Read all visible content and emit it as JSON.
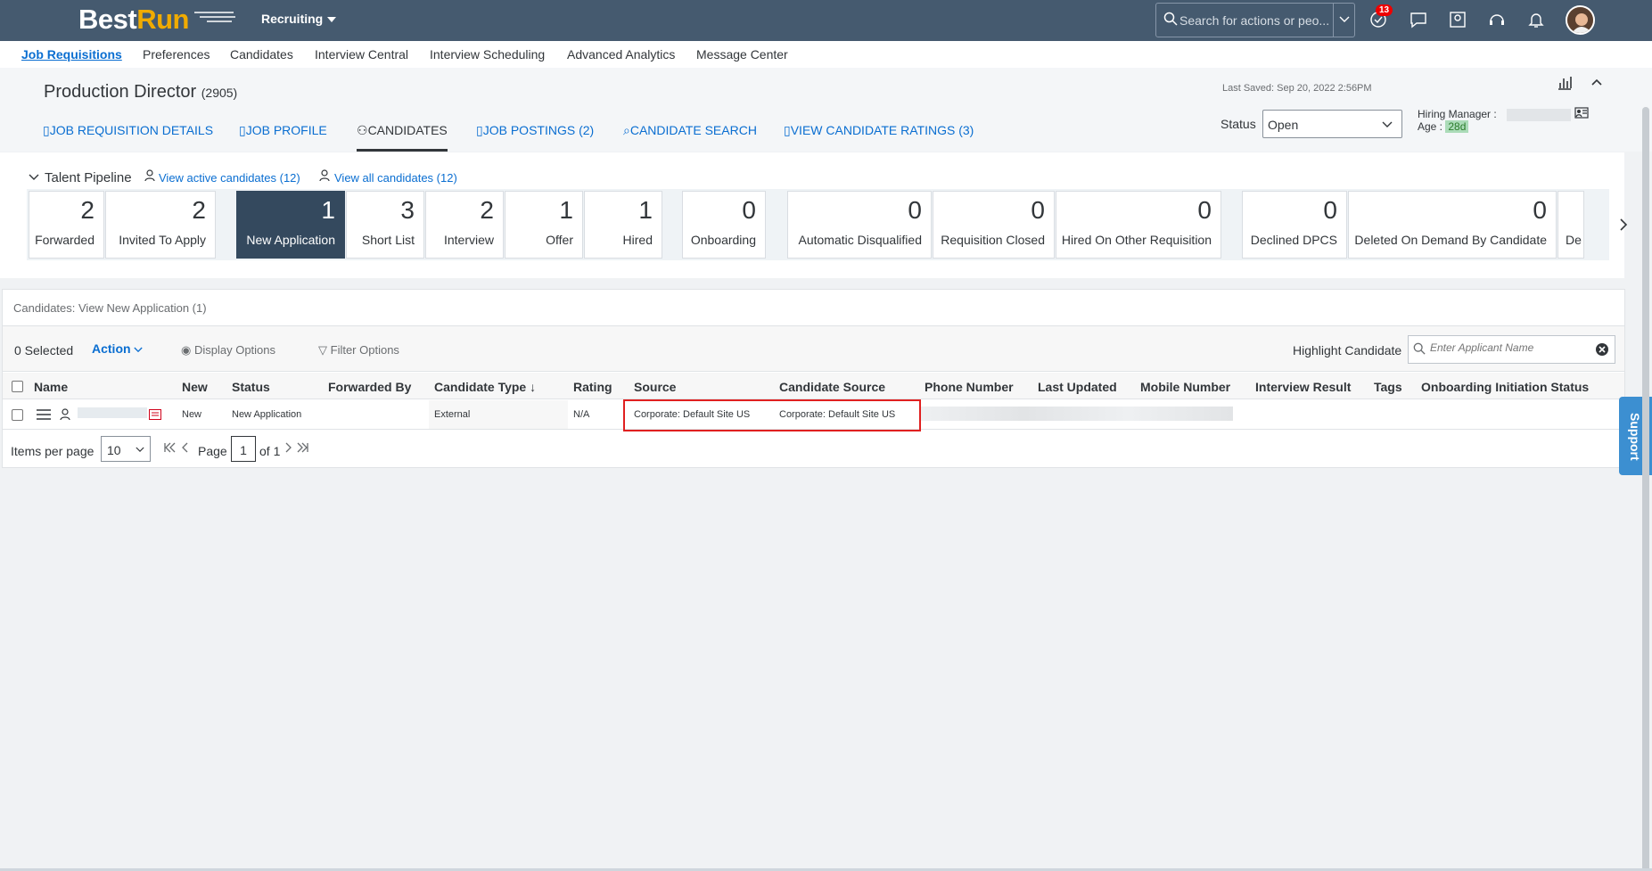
{
  "shell": {
    "logo_best": "Best",
    "logo_run": "Run",
    "module": "Recruiting",
    "search_placeholder": "Search for actions or peo...",
    "notification_count": "13"
  },
  "topnav": [
    "Job Requisitions",
    "Preferences",
    "Candidates",
    "Interview Central",
    "Interview Scheduling",
    "Advanced Analytics",
    "Message Center"
  ],
  "header": {
    "title": "Production Director",
    "req_id": "(2905)",
    "last_saved": "Last Saved: Sep 20, 2022 2:56PM",
    "status_label": "Status",
    "status_value": "Open",
    "hiring_manager_label": "Hiring Manager :",
    "age_label": "Age :",
    "age_value": "28d",
    "tabs": [
      "JOB REQUISITION DETAILS",
      "JOB PROFILE",
      "CANDIDATES",
      "JOB POSTINGS (2)",
      "CANDIDATE SEARCH",
      "VIEW CANDIDATE RATINGS (3)"
    ]
  },
  "pipeline": {
    "title": "Talent Pipeline",
    "active_link": "View active candidates (12)",
    "all_link": "View all candidates (12)",
    "stages": [
      {
        "count": "2",
        "label": "Forwarded"
      },
      {
        "count": "2",
        "label": "Invited To Apply"
      },
      {
        "count": "1",
        "label": "New Application"
      },
      {
        "count": "3",
        "label": "Short List"
      },
      {
        "count": "2",
        "label": "Interview"
      },
      {
        "count": "1",
        "label": "Offer"
      },
      {
        "count": "1",
        "label": "Hired"
      },
      {
        "count": "0",
        "label": "Onboarding"
      },
      {
        "count": "0",
        "label": "Automatic Disqualified"
      },
      {
        "count": "0",
        "label": "Requisition Closed"
      },
      {
        "count": "0",
        "label": "Hired On Other Requisition"
      },
      {
        "count": "0",
        "label": "Declined DPCS"
      },
      {
        "count": "0",
        "label": "Deleted On Demand By Candidate"
      },
      {
        "count": "",
        "label": "De"
      }
    ]
  },
  "candidates": {
    "heading": "Candidates: View New Application (1)",
    "selected": "0 Selected",
    "action": "Action",
    "display_options": "Display Options",
    "filter_options": "Filter Options",
    "highlight_label": "Highlight Candidate",
    "highlight_placeholder": "Enter Applicant Name",
    "columns": [
      "Name",
      "New",
      "Status",
      "Forwarded By",
      "Candidate Type",
      "Rating",
      "Source",
      "Candidate Source",
      "Phone Number",
      "Last Updated",
      "Mobile Number",
      "Interview Result",
      "Tags",
      "Onboarding Initiation Status"
    ],
    "row": {
      "new": "New",
      "status": "New Application",
      "forwarded_by": "",
      "candidate_type": "External",
      "rating": "N/A",
      "source": "Corporate: Default Site US",
      "candidate_source": "Corporate: Default Site US"
    },
    "pager": {
      "items_label": "Items per page",
      "items_value": "10",
      "page_label": "Page",
      "page_value": "1",
      "of_label": "of 1"
    }
  },
  "support": "Support"
}
